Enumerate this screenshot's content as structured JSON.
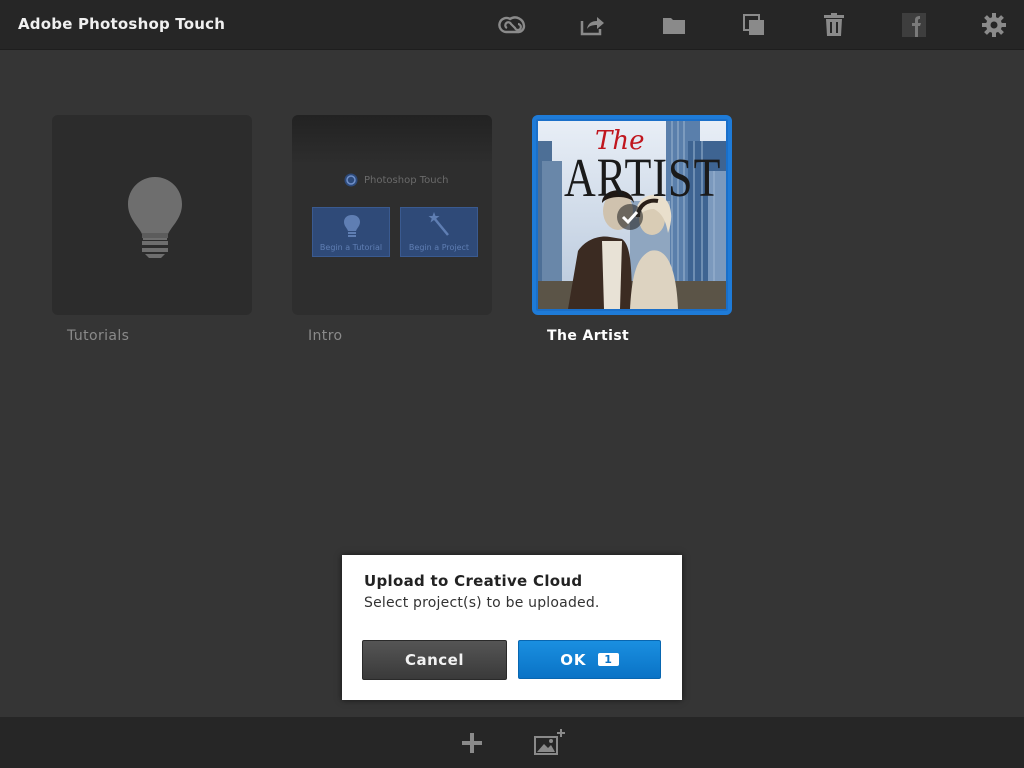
{
  "app": {
    "title": "Adobe Photoshop Touch"
  },
  "toolbar": {
    "icons": [
      "creative-cloud-icon",
      "share-icon",
      "folder-icon",
      "duplicate-icon",
      "trash-icon",
      "facebook-icon",
      "gear-icon"
    ]
  },
  "projects": [
    {
      "label": "Tutorials",
      "icon": "lightbulb-icon",
      "selected": false
    },
    {
      "label": "Intro",
      "selected": false,
      "preview": {
        "brand": "Photoshop Touch",
        "cards": [
          "Begin a Tutorial",
          "Begin a Project"
        ]
      }
    },
    {
      "label": "The Artist",
      "selected": true,
      "poster_text": {
        "the": "The",
        "artist": "ARTIST"
      }
    }
  ],
  "bottombar": {
    "icons": [
      "add-icon",
      "add-image-icon"
    ]
  },
  "dialog": {
    "title": "Upload to Creative Cloud",
    "message": "Select project(s) to be uploaded.",
    "cancel_label": "Cancel",
    "ok_label": "OK",
    "selected_count": "1"
  },
  "colors": {
    "accent": "#1e7bd8",
    "ok_button": "#0a7ed4",
    "background": "#353535",
    "bar": "#262626"
  }
}
